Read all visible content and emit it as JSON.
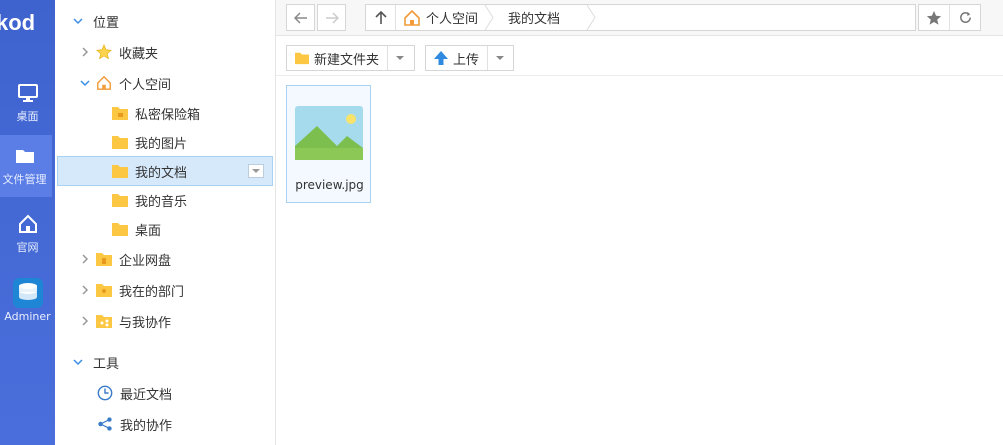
{
  "app": {
    "logo": "kod"
  },
  "nav": [
    {
      "label": "桌面",
      "icon": "monitor-icon"
    },
    {
      "label": "文件管理",
      "icon": "folder-icon"
    },
    {
      "label": "官网",
      "icon": "home-icon"
    },
    {
      "label": "Adminer",
      "icon": "database-icon"
    }
  ],
  "tree": {
    "section_locations": "位置",
    "favorites": "收藏夹",
    "personal_space": "个人空间",
    "children": [
      "私密保险箱",
      "我的图片",
      "我的文档",
      "我的音乐",
      "桌面"
    ],
    "enterprise_drive": "企业网盘",
    "my_department": "我在的部门",
    "shared_with_me": "与我协作",
    "section_tools": "工具",
    "recent_docs": "最近文档",
    "my_collab": "我的协作"
  },
  "breadcrumb": {
    "items": [
      "个人空间",
      "我的文档"
    ]
  },
  "toolbar": {
    "new_folder": "新建文件夹",
    "upload": "上传"
  },
  "files": [
    {
      "name": "preview.jpg"
    }
  ],
  "colors": {
    "nav_bg": "#4a6fdc",
    "accent": "#3a8ee6",
    "folder": "#fcc844",
    "selected_bg": "#d6e9fb"
  }
}
